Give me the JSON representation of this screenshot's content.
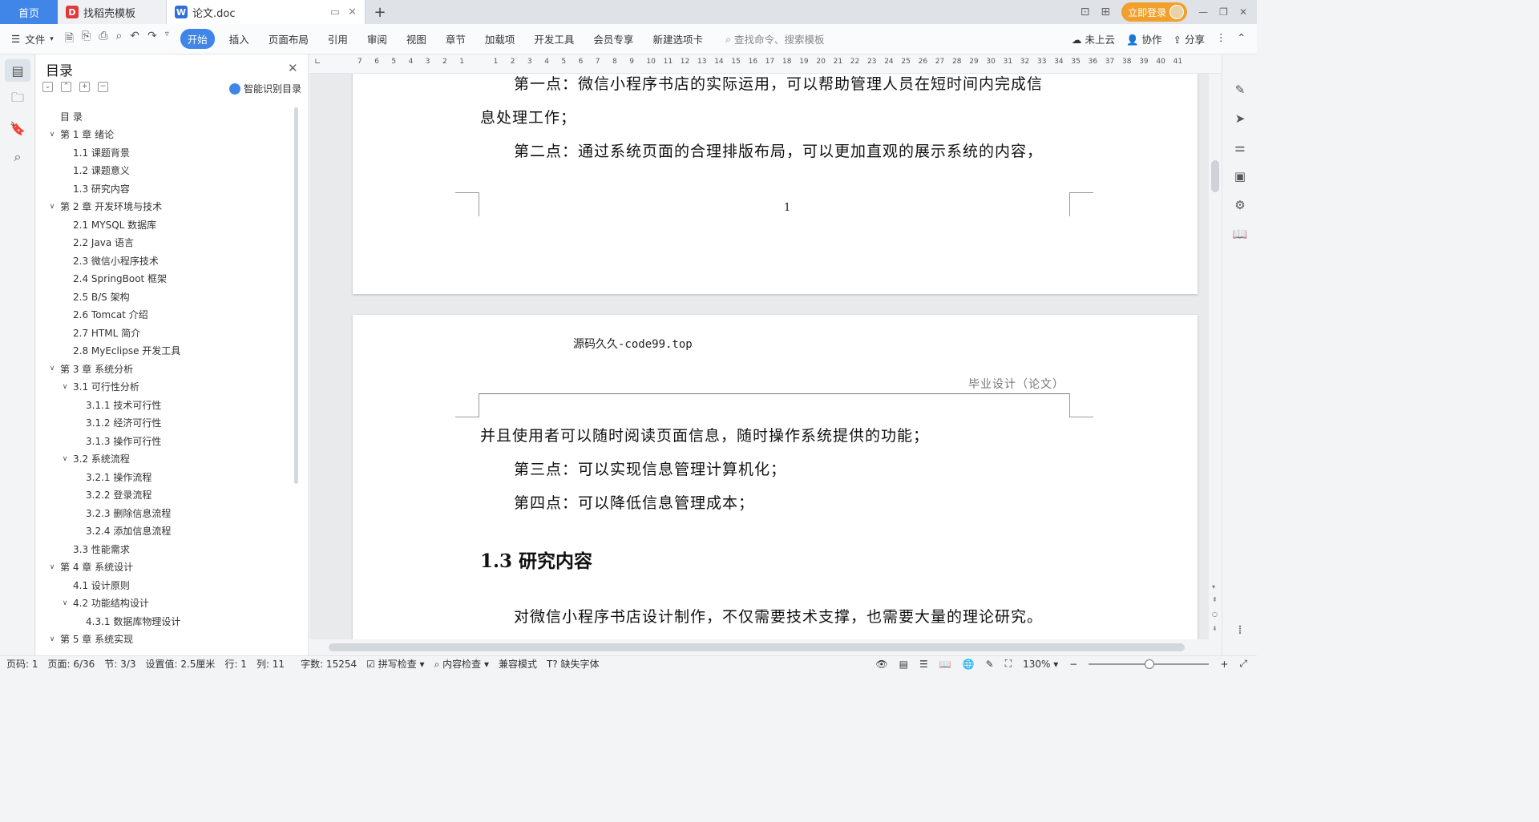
{
  "tabs": {
    "home": "首页",
    "template": "找稻壳模板",
    "doc": "论文.doc",
    "add": "+"
  },
  "window": {
    "login": "立即登录"
  },
  "toolbar": {
    "file": "文件",
    "items": [
      "开始",
      "插入",
      "页面布局",
      "引用",
      "审阅",
      "视图",
      "章节",
      "加载项",
      "开发工具",
      "会员专享",
      "新建选项卡"
    ],
    "search_placeholder": "查找命令、搜索模板",
    "cloud": "未上云",
    "collab": "协作",
    "share": "分享"
  },
  "toc": {
    "title": "目录",
    "smart": "智能识别目录",
    "items": [
      {
        "label": "目  录",
        "level": 0,
        "arrow": ""
      },
      {
        "label": "第 1 章  绪论",
        "level": 0,
        "arrow": "v"
      },
      {
        "label": "1.1  课题背景",
        "level": 1,
        "arrow": ""
      },
      {
        "label": "1.2  课题意义",
        "level": 1,
        "arrow": ""
      },
      {
        "label": "1.3  研究内容",
        "level": 1,
        "arrow": ""
      },
      {
        "label": "第 2 章  开发环境与技术",
        "level": 0,
        "arrow": "v"
      },
      {
        "label": "2.1 MYSQL 数据库",
        "level": 1,
        "arrow": ""
      },
      {
        "label": "2.2 Java 语言",
        "level": 1,
        "arrow": ""
      },
      {
        "label": "2.3  微信小程序技术",
        "level": 1,
        "arrow": ""
      },
      {
        "label": "2.4 SpringBoot 框架",
        "level": 1,
        "arrow": ""
      },
      {
        "label": "2.5 B/S 架构",
        "level": 1,
        "arrow": ""
      },
      {
        "label": "2.6 Tomcat  介绍",
        "level": 1,
        "arrow": ""
      },
      {
        "label": "2.7 HTML 简介",
        "level": 1,
        "arrow": ""
      },
      {
        "label": "2.8 MyEclipse 开发工具",
        "level": 1,
        "arrow": ""
      },
      {
        "label": "第 3 章  系统分析",
        "level": 0,
        "arrow": "v"
      },
      {
        "label": "3.1  可行性分析",
        "level": 1,
        "arrow": "v"
      },
      {
        "label": "3.1.1  技术可行性",
        "level": 2,
        "arrow": ""
      },
      {
        "label": "3.1.2  经济可行性",
        "level": 2,
        "arrow": ""
      },
      {
        "label": "3.1.3  操作可行性",
        "level": 2,
        "arrow": ""
      },
      {
        "label": "3.2  系统流程",
        "level": 1,
        "arrow": "v"
      },
      {
        "label": "3.2.1  操作流程",
        "level": 2,
        "arrow": ""
      },
      {
        "label": "3.2.2  登录流程",
        "level": 2,
        "arrow": ""
      },
      {
        "label": "3.2.3  删除信息流程",
        "level": 2,
        "arrow": ""
      },
      {
        "label": "3.2.4  添加信息流程",
        "level": 2,
        "arrow": ""
      },
      {
        "label": "3.3  性能需求",
        "level": 1,
        "arrow": ""
      },
      {
        "label": "第 4 章  系统设计",
        "level": 0,
        "arrow": "v"
      },
      {
        "label": "4.1  设计原则",
        "level": 1,
        "arrow": ""
      },
      {
        "label": "4.2  功能结构设计",
        "level": 1,
        "arrow": "v"
      },
      {
        "label": "4.3.1  数据库物理设计",
        "level": 2,
        "arrow": ""
      },
      {
        "label": "第 5 章  系统实现",
        "level": 0,
        "arrow": "v"
      }
    ]
  },
  "ruler": [
    "7",
    "6",
    "5",
    "4",
    "3",
    "2",
    "1",
    "",
    "1",
    "2",
    "3",
    "4",
    "5",
    "6",
    "7",
    "8",
    "9",
    "10",
    "11",
    "12",
    "13",
    "14",
    "15",
    "16",
    "17",
    "18",
    "19",
    "20",
    "21",
    "22",
    "23",
    "24",
    "25",
    "26",
    "27",
    "28",
    "29",
    "30",
    "31",
    "32",
    "33",
    "34",
    "35",
    "36",
    "37",
    "38",
    "39",
    "40",
    "41"
  ],
  "doc": {
    "p1_line1": "第一点：微信小程序书店的实际运用，可以帮助管理人员在短时间内完成信",
    "p1_line2": "息处理工作；",
    "p2": "第二点：通过系统页面的合理排版布局，可以更加直观的展示系统的内容，",
    "page_number": "1",
    "watermark": "源码久久-code99.top",
    "header": "毕业设计（论文）",
    "p2_cont": "并且使用者可以随时阅读页面信息，随时操作系统提供的功能；",
    "p3": "第三点：可以实现信息管理计算机化；",
    "p4": "第四点：可以降低信息管理成本；",
    "heading": "1.3  研究内容",
    "p5": "对微信小程序书店设计制作，不仅需要技术支撑，也需要大量的理论研究。"
  },
  "status": {
    "page_code": "页码: 1",
    "page": "页面: 6/36",
    "section": "节: 3/3",
    "setting": "设置值: 2.5厘米",
    "row": "行: 1",
    "col": "列: 11",
    "words": "字数: 15254",
    "spell": "拼写检查",
    "content": "内容检查",
    "compat": "兼容模式",
    "missing_font": "缺失字体",
    "zoom": "130%"
  }
}
